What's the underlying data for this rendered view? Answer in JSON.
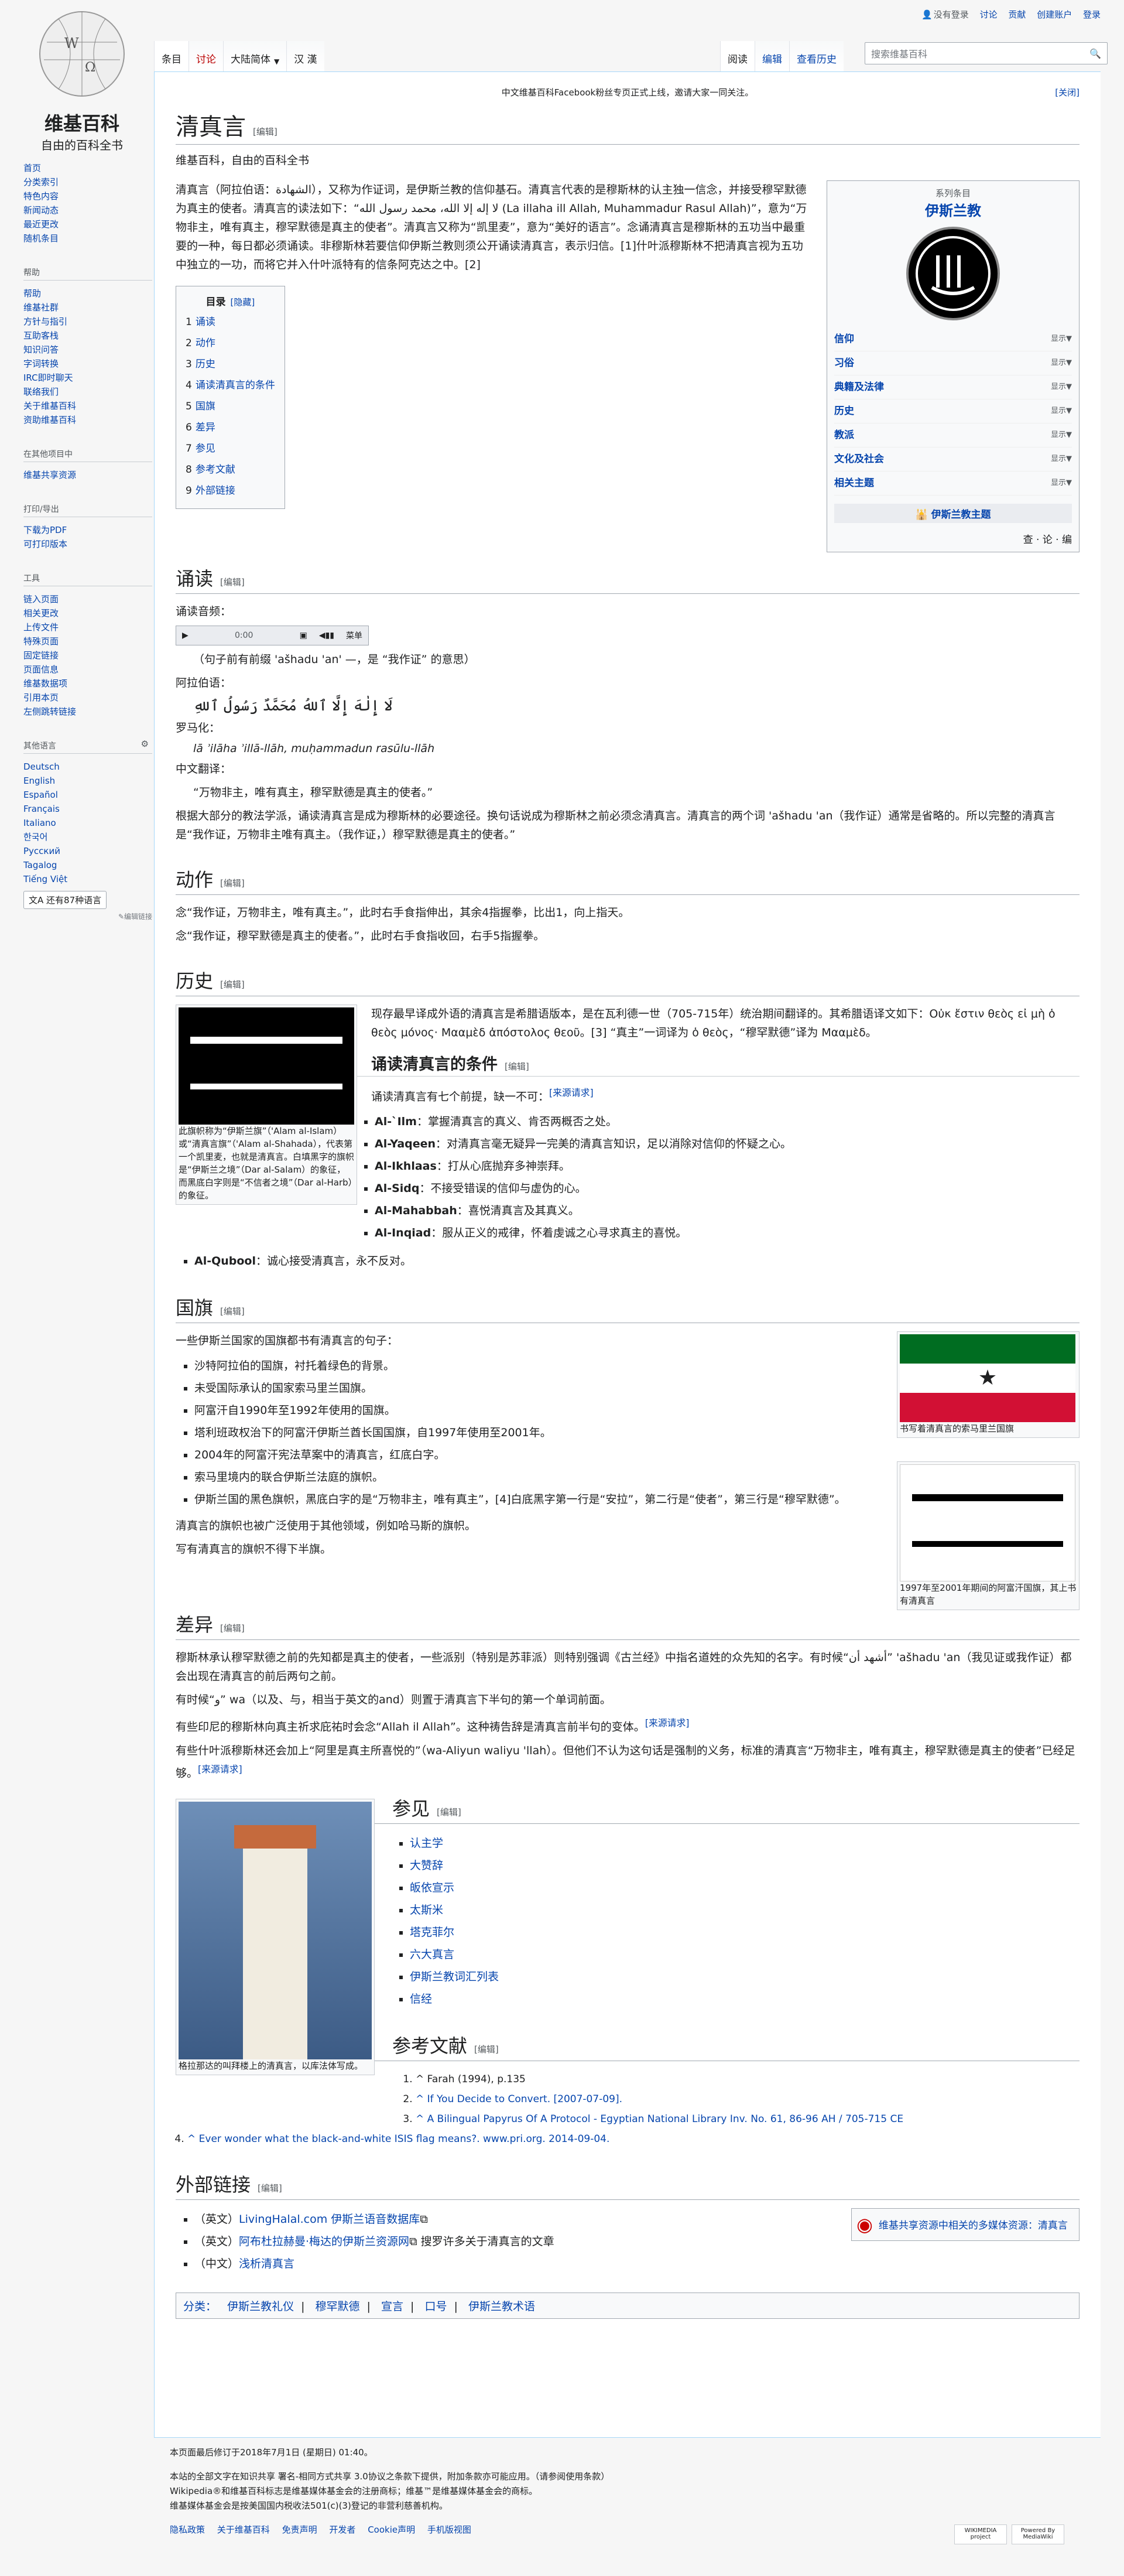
{
  "logo": {
    "title": "维基百科",
    "tagline": "自由的百科全书"
  },
  "personal": [
    "没有登录",
    "讨论",
    "贡献",
    "创建账户",
    "登录"
  ],
  "tabs_left": [
    "条目",
    "讨论",
    "大陆简体",
    "汉 漢"
  ],
  "tabs_right": [
    "阅读",
    "编辑",
    "查看历史"
  ],
  "search_placeholder": "搜索维基百科",
  "sidebar": {
    "main": [
      "首页",
      "分类索引",
      "特色内容",
      "新闻动态",
      "最近更改",
      "随机条目"
    ],
    "help_title": "帮助",
    "help": [
      "帮助",
      "维基社群",
      "方针与指引",
      "互助客栈",
      "知识问答",
      "字词转换",
      "IRC即时聊天",
      "联络我们",
      "关于维基百科",
      "资助维基百科"
    ],
    "other_title": "在其他项目中",
    "other": [
      "维基共享资源"
    ],
    "print_title": "打印/导出",
    "print": [
      "下载为PDF",
      "可打印版本"
    ],
    "tools_title": "工具",
    "tools": [
      "链入页面",
      "相关更改",
      "上传文件",
      "特殊页面",
      "固定链接",
      "页面信息",
      "维基数据项",
      "引用本页",
      "左侧跳转链接"
    ],
    "lang_title": "其他语言",
    "langs": [
      "Deutsch",
      "English",
      "Español",
      "Français",
      "Italiano",
      "한국어",
      "Русский",
      "Tagalog",
      "Tiếng Việt"
    ],
    "lang_more": "还有87种语言",
    "edit_links": "✎编辑链接"
  },
  "notice": {
    "text": "中文维基百科Facebook粉丝专页正式上线，邀请大家一同关注。",
    "close": "[关闭]"
  },
  "title": "清真言",
  "edit": "[编辑]",
  "subtitle": "维基百科，自由的百科全书",
  "intro": "清真言（阿拉伯语：الشهادة），又称为作证词，是伊斯兰教的信仰基石。清真言代表的是穆斯林的认主独一信念，并接受穆罕默德为真主的使者。清真言的读法如下：“لا إله إلا الله، محمد رسول الله‎ (La illaha ill Allah, Muhammadur Rasul Allah)”，意为“万物非主，唯有真主，穆罕默德是真主的使者”。清真言又称为“凯里麦”，意为“美好的语言”。念诵清真言是穆斯林的五功当中最重要的一种，每日都必须诵读。非穆斯林若要信仰伊斯兰教则须公开诵读清真言，表示归信。[1]什叶派穆斯林不把清真言视为五功中独立的一功，而将它并入什叶派特有的信条阿克达之中。[2]",
  "infobox": {
    "series": "系列条目",
    "title": "伊斯兰教",
    "rows": [
      {
        "label": "信仰",
        "show": "显示▼"
      },
      {
        "label": "习俗",
        "show": "显示▼"
      },
      {
        "label": "典籍及法律",
        "show": "显示▼"
      },
      {
        "label": "历史",
        "show": "显示▼"
      },
      {
        "label": "教派",
        "show": "显示▼"
      },
      {
        "label": "文化及社会",
        "show": "显示▼"
      },
      {
        "label": "相关主题",
        "show": "显示▼"
      }
    ],
    "portal": "伊斯兰教主题",
    "vte": "查 · 论 · 编"
  },
  "toc": {
    "title": "目录",
    "hide": "[隐藏]",
    "items": [
      "诵读",
      "动作",
      "历史",
      "诵读清真言的条件",
      "国旗",
      "差异",
      "参见",
      "参考文献",
      "外部链接"
    ]
  },
  "sections": {
    "recite": {
      "heading": "诵读",
      "audio_label": "诵读音频：",
      "player": {
        "time": "0:00",
        "menu": "菜单"
      },
      "audio_caption": "（句子前有前缀 'ašhadu 'an' —，是 “我作证” 的意思）",
      "arabic_label": "阿拉伯语：",
      "arabic": "لَا إِلٰهَ إِلَّا ٱللهُ مُحَمَّدٌ رَسُولُ ٱللهِ",
      "roman_label": "罗马化：",
      "roman": "lā ʾilāha ʾillā-llāh, muḥammadun rasūlu-llāh",
      "chinese_label": "中文翻译：",
      "chinese": "“万物非主，唯有真主，穆罕默德是真主的使者。”",
      "para": "根据大部分的教法学派，诵读清真言是成为穆斯林的必要途径。换句话说成为穆斯林之前必须念清真言。清真言的两个词 'ašhadu 'an（我作证）通常是省略的。所以完整的清真言是“我作证，万物非主唯有真主。（我作证，）穆罕默德是真主的使者。”"
    },
    "action": {
      "heading": "动作",
      "p1": "念“我作证，万物非主，唯有真主。”，此时右手食指伸出，其余4指握拳，比出1，向上指天。",
      "p2": "念“我作证，穆罕默德是真主的使者。”，此时右手食指收回，右手5指握拳。"
    },
    "history": {
      "heading": "历史",
      "text": "现存最早译成外语的清真言是希腊语版本，是在瓦利德一世（705-715年）统治期间翻译的。其希腊语译文如下：Οὐκ ἔστιν θεὸς εἰ μὴ ὁ θεὸς μόνος· Μααμὲδ ἀπόστολος θεοῦ。[3] “真主”一词译为 ὁ θεὸς，“穆罕默德”译为 Μααμὲδ。",
      "caption": "此旗帜称为“伊斯兰旗”（'Alam al-Islam）或“清真言旗”（'Alam al-Shahada），代表第一个凯里麦，也就是清真言。白填黑字的旗帜是“伊斯兰之境”（Dar al-Salam）的象征，而黑底白字则是“不信者之境”（Dar al-Harb）的象征。"
    },
    "conditions": {
      "heading": "诵读清真言的条件",
      "intro": "诵读清真言有七个前提，缺一不可：",
      "cite": "[来源请求]",
      "items": [
        {
          "term": "Al-`Ilm",
          "text": "：掌握清真言的真义、肯否两概否之处。"
        },
        {
          "term": "Al-Yaqeen",
          "text": "：对清真言毫无疑异一完美的清真言知识，足以消除对信仰的怀疑之心。"
        },
        {
          "term": "Al-Ikhlaas",
          "text": "：打从心底抛弃多神崇拜。"
        },
        {
          "term": "Al-Sidq",
          "text": "：不接受错误的信仰与虚伪的心。"
        },
        {
          "term": "Al-Mahabbah",
          "text": "：喜悦清真言及其真义。"
        },
        {
          "term": "Al-Inqiad",
          "text": "：服从正义的戒律，怀着虔诚之心寻求真主的喜悦。"
        },
        {
          "term": "Al-Qubool",
          "text": "：诚心接受清真言，永不反对。"
        }
      ]
    },
    "flags": {
      "heading": "国旗",
      "intro": "一些伊斯兰国家的国旗都书有清真言的句子：",
      "items": [
        "沙特阿拉伯的国旗，衬托着绿色的背景。",
        "未受国际承认的国家索马里兰国旗。",
        "阿富汗自1990年至1992年使用的国旗。",
        "塔利班政权治下的阿富汗伊斯兰酋长国国旗，自1997年使用至2001年。",
        "2004年的阿富汗宪法草案中的清真言，红底白字。",
        "索马里境内的联合伊斯兰法庭的旗帜。",
        "伊斯兰国的黑色旗帜，黑底白字的是“万物非主，唯有真主”，[4]白底黑字第一行是“安拉”，第二行是“使者”，第三行是“穆罕默德”。"
      ],
      "p1": "清真言的旗帜也被广泛使用于其他领域，例如哈马斯的旗帜。",
      "p2": "写有清真言的旗帜不得下半旗。",
      "cap1": "书写着清真言的索马里兰国旗",
      "cap2": "1997年至2001年期间的阿富汗国旗，其上书有清真言"
    },
    "diff": {
      "heading": "差异",
      "p1": "穆斯林承认穆罕默德之前的先知都是真主的使者，一些派别（特别是苏菲派）则特别强调《古兰经》中指名道姓的众先知的名字。有时候“أشهد أن” 'ašhadu 'an（我见证或我作证）都会出现在清真言的前后两句之前。",
      "p2": "有时候“و” wa（以及、与，相当于英文的and）则置于清真言下半句的第一个单词前面。",
      "p3": "有些印尼的穆斯林向真主祈求庇祐时会念“Allah il Allah”。这种祷告辞是清真言前半句的变体。",
      "p3cite": "[来源请求]",
      "p4": "有些什叶派穆斯林还会加上“阿里是真主所喜悦的”（wa-Aliyun waliyu 'llah）。但他们不认为这句话是强制的义务，标准的清真言“万物非主，唯有真主，穆罕默德是真主的使者”已经足够。",
      "p4cite": "[来源请求]"
    },
    "seealso": {
      "heading": "参见",
      "items": [
        "认主学",
        "大赞辞",
        "皈依宣示",
        "太斯米",
        "塔克菲尔",
        "六大真言",
        "伊斯兰教词汇列表",
        "信经"
      ],
      "caption": "格拉那达的叫拜楼上的清真言，以库法体写成。"
    },
    "refs": {
      "heading": "参考文献",
      "items": [
        "^ Farah (1994), p.135",
        "^ If You Decide to Convert. [2007-07-09].",
        "^ A Bilingual Papyrus Of A Protocol - Egyptian National Library Inv. No. 61, 86-96 AH / 705-715 CE",
        "^ Ever wonder what the black-and-white ISIS flag means?. www.pri.org. 2014-09-04."
      ]
    },
    "external": {
      "heading": "外部链接",
      "items": [
        {
          "lang": "（英文）",
          "text": "LivingHalal.com 伊斯兰语音数据库"
        },
        {
          "lang": "（英文）",
          "text": "阿布杜拉赫曼·梅达的伊斯兰资源网",
          "extra": " 搜罗许多关于清真言的文章"
        },
        {
          "lang": "（中文）",
          "text": "浅析清真言"
        }
      ],
      "commons": "维基共享资源中相关的多媒体资源：清真言"
    }
  },
  "categories": {
    "label": "分类：",
    "items": [
      "伊斯兰教礼仪",
      "穆罕默德",
      "宣言",
      "口号",
      "伊斯兰教术语"
    ]
  },
  "footer": {
    "lines": [
      "本页面最后修订于2018年7月1日 (星期日) 01:40。",
      "本站的全部文字在知识共享 署名-相同方式共享 3.0协议之条款下提供，附加条款亦可能应用。（请参阅使用条款）",
      "Wikipedia®和维基百科标志是维基媒体基金会的注册商标；维基™是维基媒体基金会的商标。",
      "维基媒体基金会是按美国国内税收法501(c)(3)登记的非营利慈善机构。"
    ],
    "links": [
      "隐私政策",
      "关于维基百科",
      "免责声明",
      "开发者",
      "Cookie声明",
      "手机版视图"
    ],
    "icons": [
      "WIKIMEDIA project",
      "Powered By MediaWiki"
    ]
  }
}
